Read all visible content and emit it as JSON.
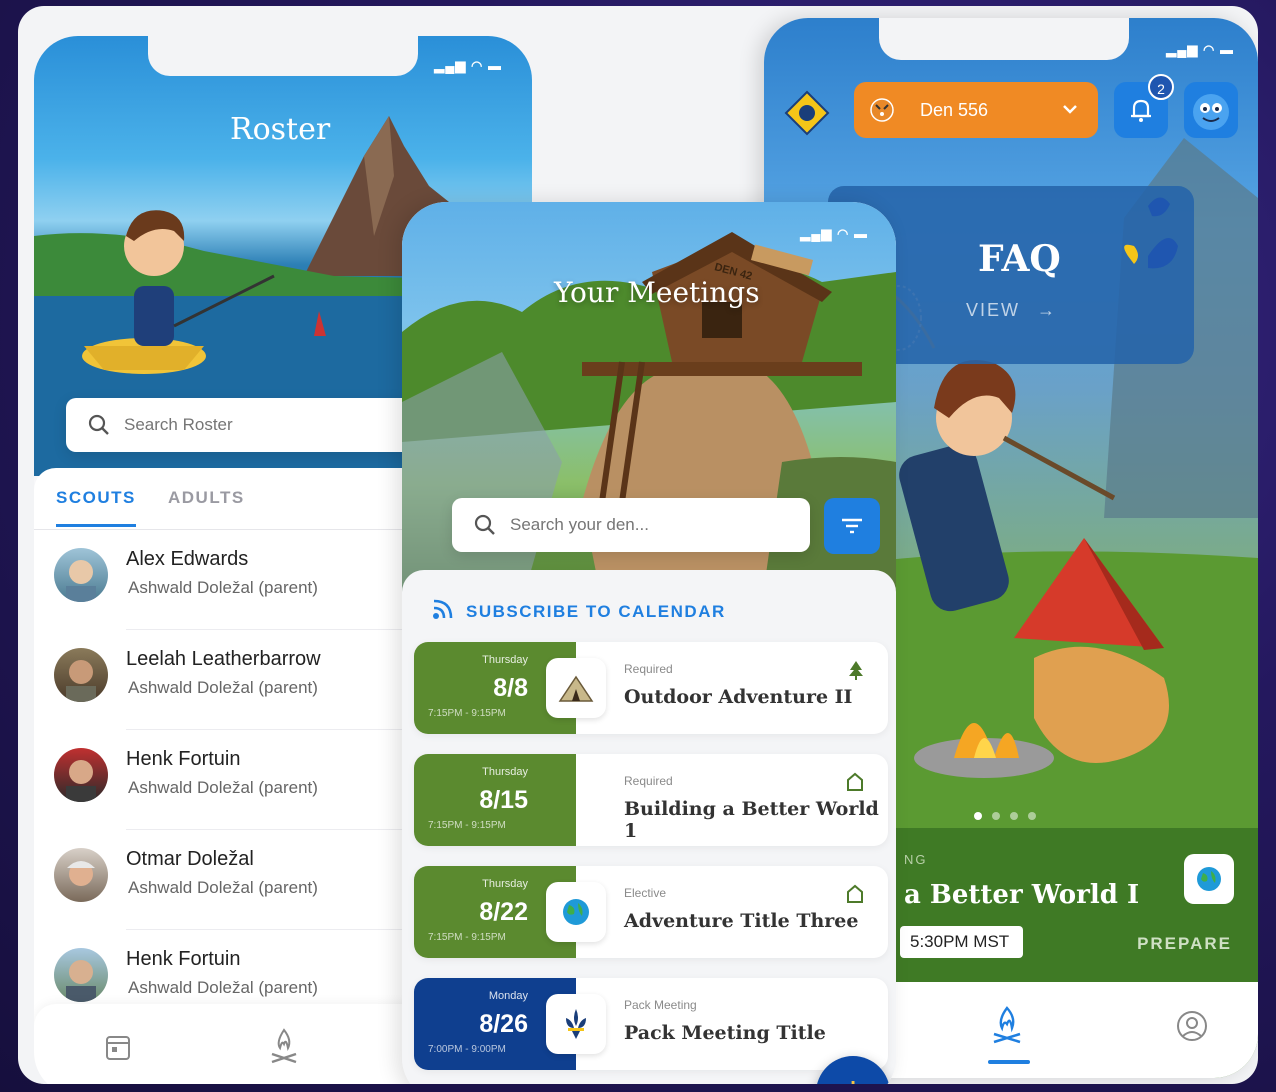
{
  "roster": {
    "title": "Roster",
    "search_placeholder": "Search Roster",
    "tabs": [
      "SCOUTS",
      "ADULTS"
    ],
    "members": [
      {
        "name": "Alex Edwards",
        "guardian": "Ashwald Doležal (parent)"
      },
      {
        "name": "Leelah Leatherbarrow",
        "guardian": "Ashwald Doležal (parent)"
      },
      {
        "name": "Henk Fortuin",
        "guardian": "Ashwald Doležal (parent)"
      },
      {
        "name": "Otmar Doležal",
        "guardian": "Ashwald Doležal (parent)"
      },
      {
        "name": "Henk Fortuin",
        "guardian": "Ashwald Doležal (parent)"
      }
    ]
  },
  "meetings": {
    "title": "Your Meetings",
    "den_sign": "DEN 42",
    "search_placeholder": "Search your den...",
    "subscribe_label": "SUBSCRIBE TO CALENDAR",
    "items": [
      {
        "weekday": "Thursday",
        "date": "8/8",
        "time": "7:15PM - 9:15PM",
        "type": "Required",
        "title": "Outdoor Adventure II",
        "color": "#5b8a2f"
      },
      {
        "weekday": "Thursday",
        "date": "8/15",
        "time": "7:15PM - 9:15PM",
        "type": "Required",
        "title": "Building a Better World 1",
        "color": "#5b8a2f"
      },
      {
        "weekday": "Thursday",
        "date": "8/22",
        "time": "7:15PM - 9:15PM",
        "type": "Elective",
        "title": "Adventure Title Three",
        "color": "#5b8a2f"
      },
      {
        "weekday": "Monday",
        "date": "8/26",
        "time": "7:00PM - 9:00PM",
        "type": "Pack Meeting",
        "title": "Pack Meeting Title",
        "color": "#0f3f8f"
      }
    ]
  },
  "home": {
    "den_label": "Den 556",
    "notification_count": "2",
    "faq_title": "FAQ",
    "faq_action": "VIEW",
    "next_label": "NG",
    "next_title": "a Better World I",
    "next_time": "5:30PM MST",
    "next_action": "PREPARE"
  },
  "colors": {
    "accent_blue": "#1f7fe0",
    "den_orange": "#f08a24",
    "scout_green": "#5b8a2f",
    "pack_navy": "#0f3f8f"
  }
}
